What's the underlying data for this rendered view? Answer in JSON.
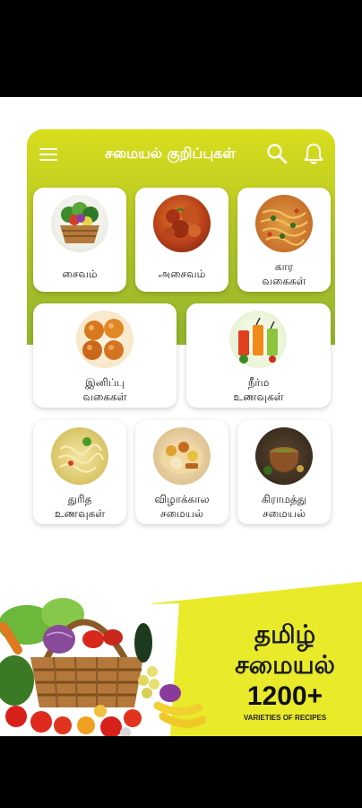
{
  "app": {
    "title": "சமையல் குறிப்புகள்"
  },
  "categories": [
    {
      "label": "சைவம்",
      "icon": "vegetable-basket"
    },
    {
      "label": "அசைவம்",
      "icon": "chicken-curry"
    },
    {
      "label": "கார\nவகைகள்",
      "icon": "spicy-noodles"
    },
    {
      "label": "இனிப்பு\nவகைகள்",
      "icon": "sweets"
    },
    {
      "label": "நீர்ம\nஉணவுகள்",
      "icon": "juices"
    },
    {
      "label": "துரித\nஉணவுகள்",
      "icon": "noodles"
    },
    {
      "label": "விழாக்கால\nசமையல்",
      "icon": "festival-meal"
    },
    {
      "label": "கிராமத்து\nசமையல்",
      "icon": "clay-pot"
    }
  ],
  "banner": {
    "line1": "தமிழ்",
    "line2": "சமையல்",
    "count": "1200+",
    "subtitle": "VARIETIES OF RECIPES"
  },
  "colors": {
    "accent_top": "#d8de1c",
    "accent_bottom": "#93b52e",
    "banner_yellow": "#e8ea2a"
  }
}
